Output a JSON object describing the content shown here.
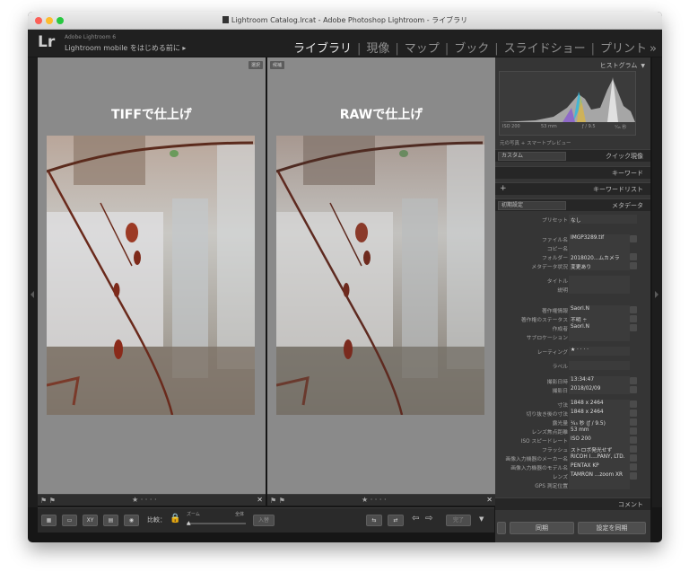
{
  "window": {
    "title": "Lightroom Catalog.lrcat - Adobe Photoshop Lightroom - ライブラリ"
  },
  "header": {
    "logo": "Lr",
    "version": "Adobe Lightroom 6",
    "mobile_prompt": "Lightroom mobile をはじめる前に ▸",
    "modules": [
      "ライブラリ",
      "現像",
      "マップ",
      "ブック",
      "スライドショー",
      "プリント"
    ],
    "more": "»",
    "separator": "|"
  },
  "panes": [
    {
      "tag": "選択",
      "heading": "TIFFで仕上げ",
      "stars": "★ · · · ·"
    },
    {
      "tag": "候補",
      "heading": "RAWで仕上げ",
      "stars": "★ · · · ·"
    }
  ],
  "bottom_toolbar": {
    "compare_label": "比較：",
    "zoom_label": "ズーム",
    "fit_label": "全体",
    "swap_btn": "入替",
    "done_btn": "完了",
    "xy_btn": "XY"
  },
  "right_panel": {
    "histogram_title": "ヒストグラム",
    "histogram_info": [
      "ISO 200",
      "53 mm",
      "ƒ / 9.5",
      "¹⁄₄₅ 秒"
    ],
    "preview_label": "元の写真 + スマートプレビュー",
    "quick_develop": {
      "preset": "カスタム",
      "label": "クイック現像"
    },
    "keywords_label": "キーワード",
    "keyword_list_label": "キーワードリスト",
    "metadata": {
      "preset": "初期設定",
      "label": "メタデータ"
    },
    "preset_label": "プリセット",
    "preset_value": "なし",
    "fields": [
      {
        "k": "ファイル名",
        "v": "IMGP3289.tif"
      },
      {
        "k": "コピー名",
        "v": ""
      },
      {
        "k": "フォルダー",
        "v": "2018020...ムカメラ"
      },
      {
        "k": "メタデータ状況",
        "v": "変更あり"
      },
      {
        "k": "タイトル",
        "v": ""
      },
      {
        "k": "説明",
        "v": ""
      },
      {
        "k": "著作権情報",
        "v": "Saori.N"
      },
      {
        "k": "著作権のステータス",
        "v": "不明 ÷"
      },
      {
        "k": "作成者",
        "v": "Saori.N"
      },
      {
        "k": "サブロケーション",
        "v": ""
      },
      {
        "k": "レーティング",
        "v": "★ · · · ·"
      },
      {
        "k": "ラベル",
        "v": ""
      },
      {
        "k": "撮影日時",
        "v": "13:34:47"
      },
      {
        "k": "撮影日",
        "v": "2018/02/09"
      },
      {
        "k": "寸法",
        "v": "1848 x 2464"
      },
      {
        "k": "切り抜き後の寸法",
        "v": "1848 x 2464"
      },
      {
        "k": "露光量",
        "v": "¹⁄₄₅ 秒 (ƒ / 9.5)"
      },
      {
        "k": "レンズ焦点距離",
        "v": "53 mm"
      },
      {
        "k": "ISO スピードレート",
        "v": "ISO 200"
      },
      {
        "k": "フラッシュ",
        "v": "ストロボ発光せず"
      },
      {
        "k": "画像入力機器のメーカー名",
        "v": "RICOH I....PANY, LTD."
      },
      {
        "k": "画像入力機器のモデル名",
        "v": "PENTAX KP"
      },
      {
        "k": "レンズ",
        "v": "TAMRON ...zoom XR"
      },
      {
        "k": "GPS 測定位置",
        "v": ""
      }
    ],
    "comment_label": "コメント",
    "sync_btn": "同期",
    "sync_settings_btn": "設定を同期"
  }
}
